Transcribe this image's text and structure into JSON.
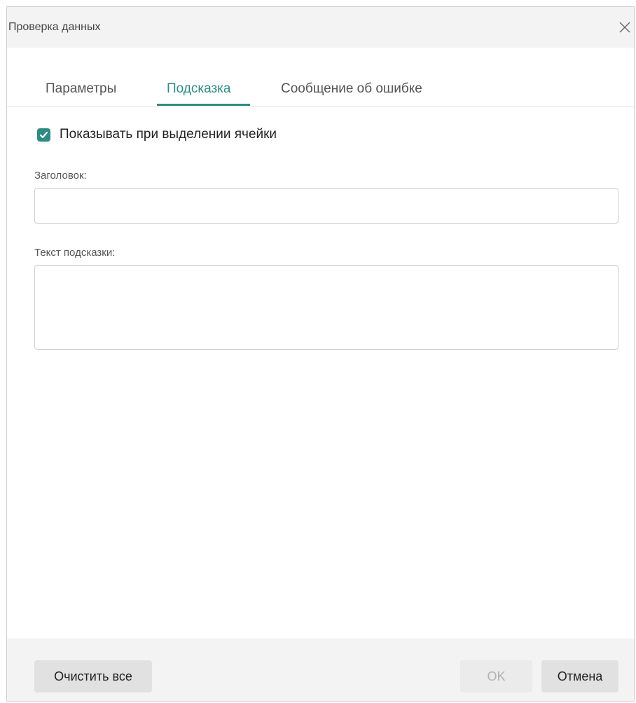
{
  "dialog": {
    "title": "Проверка данных",
    "close_icon": "close-icon"
  },
  "tabs": [
    {
      "label": "Параметры",
      "active": false
    },
    {
      "label": "Подсказка",
      "active": true
    },
    {
      "label": "Сообщение об ошибке",
      "active": false
    }
  ],
  "show_on_select": {
    "label": "Показывать при выделении ячейки",
    "checked": true
  },
  "title_field": {
    "label": "Заголовок:",
    "value": ""
  },
  "hint_field": {
    "label": "Текст подсказки:",
    "value": ""
  },
  "footer": {
    "clear_label": "Очистить все",
    "ok_label": "OK",
    "cancel_label": "Отмена"
  },
  "colors": {
    "accent": "#2e8b84",
    "titlebar_bg": "#f3f3f3",
    "disabled_text": "#b0b0b0"
  }
}
